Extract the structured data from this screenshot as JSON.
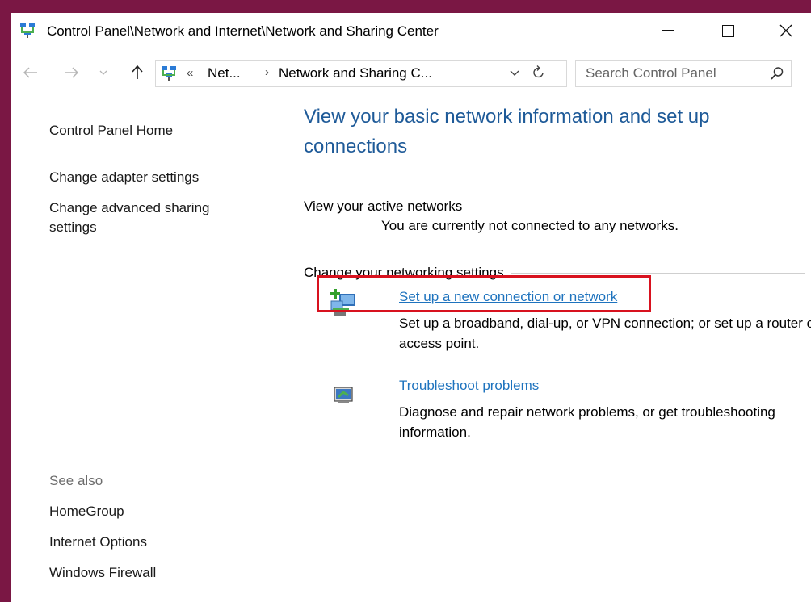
{
  "window": {
    "title": "Control Panel\\Network and Internet\\Network and Sharing Center"
  },
  "navigation": {
    "back_icon": "arrow-left-icon",
    "forward_icon": "arrow-right-icon",
    "up_icon": "arrow-up-icon",
    "breadcrumb_overflow": "«",
    "breadcrumbs": [
      {
        "label": "Net..."
      },
      {
        "label": "Network and Sharing C..."
      }
    ],
    "search": {
      "placeholder": "Search Control Panel"
    }
  },
  "sidebar": {
    "items": [
      {
        "label": "Control Panel Home"
      },
      {
        "label": "Change adapter settings"
      },
      {
        "label": "Change advanced sharing settings"
      }
    ],
    "see_also_label": "See also",
    "see_also": [
      {
        "label": "HomeGroup"
      },
      {
        "label": "Internet Options"
      },
      {
        "label": "Windows Firewall"
      }
    ]
  },
  "main": {
    "heading": "View your basic network information and set up connections",
    "active_networks": {
      "label": "View your active networks",
      "status": "You are currently not connected to any networks."
    },
    "networking_settings": {
      "label": "Change your networking settings",
      "tasks": [
        {
          "title": "Set up a new connection or network",
          "description": "Set up a broadband, dial-up, or VPN connection; or set up a router or access point.",
          "icon": "new-connection-icon"
        },
        {
          "title": "Troubleshoot problems",
          "description": "Diagnose and repair network problems, or get troubleshooting information.",
          "icon": "troubleshoot-icon"
        }
      ]
    }
  },
  "colors": {
    "desktop_background": "#7a1744",
    "heading_blue": "#1e5a98",
    "link_blue": "#1e73be",
    "highlight_red": "#d8121f"
  }
}
